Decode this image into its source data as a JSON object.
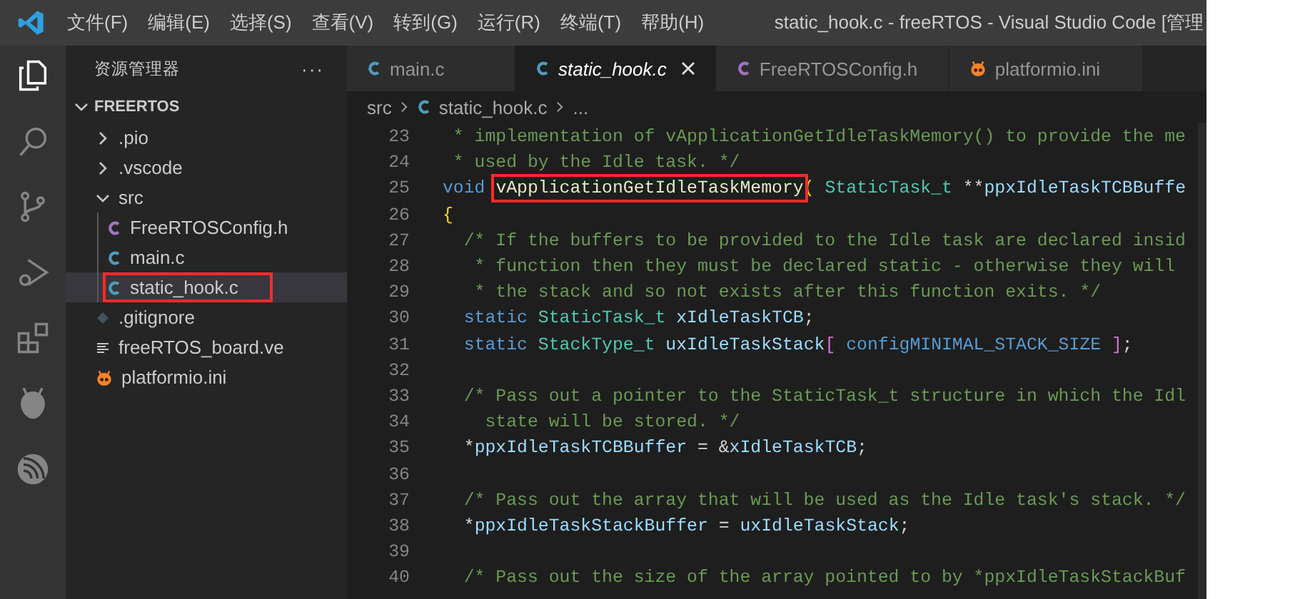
{
  "titlebar": {
    "menu": [
      "文件(F)",
      "编辑(E)",
      "选择(S)",
      "查看(V)",
      "转到(G)",
      "运行(R)",
      "终端(T)",
      "帮助(H)"
    ],
    "title": "static_hook.c - freeRTOS - Visual Studio Code [管理"
  },
  "activity_bar": [
    {
      "kind": "explorer",
      "selected": true
    },
    {
      "kind": "search",
      "selected": false
    },
    {
      "kind": "scm",
      "selected": false
    },
    {
      "kind": "debug",
      "selected": false
    },
    {
      "kind": "extensions",
      "selected": false
    },
    {
      "kind": "pio",
      "selected": false
    },
    {
      "kind": "espressif",
      "selected": false
    }
  ],
  "sidebar": {
    "title": "资源管理器",
    "more": "···",
    "section": {
      "label": "FREERTOS",
      "expanded": true
    },
    "tree": [
      {
        "label": ".pio",
        "kind": "folder",
        "expanded": false
      },
      {
        "label": ".vscode",
        "kind": "folder",
        "expanded": false
      },
      {
        "label": "src",
        "kind": "folder",
        "expanded": true,
        "children": [
          {
            "label": "FreeRTOSConfig.h",
            "kind": "h",
            "selected": false
          },
          {
            "label": "main.c",
            "kind": "c",
            "selected": false
          },
          {
            "label": "static_hook.c",
            "kind": "c",
            "selected": true,
            "boxed": true
          }
        ]
      },
      {
        "label": ".gitignore",
        "kind": "git",
        "selected": false
      },
      {
        "label": "freeRTOS_board.ve",
        "kind": "text",
        "selected": false
      },
      {
        "label": "platformio.ini",
        "kind": "pio",
        "selected": false
      }
    ]
  },
  "tabs": [
    {
      "label": "main.c",
      "kind": "c",
      "selected": false,
      "preview": false
    },
    {
      "label": "static_hook.c",
      "kind": "c",
      "selected": true,
      "preview": true
    },
    {
      "label": "FreeRTOSConfig.h",
      "kind": "h",
      "selected": false,
      "preview": false
    },
    {
      "label": "platformio.ini",
      "kind": "pio",
      "selected": false,
      "preview": false
    }
  ],
  "breadcrumb": [
    {
      "label": "src",
      "kind": "folder"
    },
    {
      "label": "static_hook.c",
      "kind": "c"
    },
    {
      "label": "...",
      "kind": "more"
    }
  ],
  "code": [
    {
      "number": "23",
      "tokens": [
        {
          "kind": "comment",
          "text": " * implementation of vApplicationGetIdleTaskMemory() to provide the me"
        }
      ]
    },
    {
      "number": "24",
      "tokens": [
        {
          "kind": "comment",
          "text": " * used by the Idle task. */"
        }
      ]
    },
    {
      "number": "25",
      "tokens": [
        {
          "kind": "keyword",
          "text": "void "
        },
        {
          "kind": "function",
          "text": "vApplicationGetIdleTaskMemory",
          "boxed": true
        },
        {
          "kind": "bracket",
          "text": "( "
        },
        {
          "kind": "type",
          "text": "StaticTask_t "
        },
        {
          "kind": "plain",
          "text": "**"
        },
        {
          "kind": "variable",
          "text": "ppxIdleTaskTCBBuffe"
        }
      ]
    },
    {
      "number": "26",
      "tokens": [
        {
          "kind": "bracket",
          "text": "{"
        }
      ]
    },
    {
      "number": "27",
      "tokens": [
        {
          "kind": "comment",
          "text": "  /* If the buffers to be provided to the Idle task are declared insid"
        }
      ]
    },
    {
      "number": "28",
      "tokens": [
        {
          "kind": "comment",
          "text": "   * function then they must be declared static - otherwise they will"
        }
      ]
    },
    {
      "number": "29",
      "tokens": [
        {
          "kind": "comment",
          "text": "   * the stack and so not exists after this function exits. */"
        }
      ]
    },
    {
      "number": "30",
      "tokens": [
        {
          "kind": "keyword",
          "text": "  static "
        },
        {
          "kind": "type",
          "text": "StaticTask_t "
        },
        {
          "kind": "variable",
          "text": "xIdleTaskTCB"
        },
        {
          "kind": "plain",
          "text": ";"
        }
      ]
    },
    {
      "number": "31",
      "tokens": [
        {
          "kind": "keyword",
          "text": "  static "
        },
        {
          "kind": "type",
          "text": "StackType_t "
        },
        {
          "kind": "variable",
          "text": "uxIdleTaskStack"
        },
        {
          "kind": "bracket2",
          "text": "[ "
        },
        {
          "kind": "macro",
          "text": "configMINIMAL_STACK_SIZE "
        },
        {
          "kind": "bracket2",
          "text": "]"
        },
        {
          "kind": "plain",
          "text": ";"
        }
      ]
    },
    {
      "number": "32"
    },
    {
      "number": "33",
      "tokens": [
        {
          "kind": "comment",
          "text": "  /* Pass out a pointer to the StaticTask_t structure in which the Idl"
        }
      ]
    },
    {
      "number": "34",
      "tokens": [
        {
          "kind": "comment",
          "text": "    state will be stored. */"
        }
      ]
    },
    {
      "number": "35",
      "tokens": [
        {
          "kind": "plain",
          "text": "  *"
        },
        {
          "kind": "variable",
          "text": "ppxIdleTaskTCBBuffer"
        },
        {
          "kind": "plain",
          "text": " = &"
        },
        {
          "kind": "variable",
          "text": "xIdleTaskTCB"
        },
        {
          "kind": "plain",
          "text": ";"
        }
      ]
    },
    {
      "number": "36"
    },
    {
      "number": "37",
      "tokens": [
        {
          "kind": "comment",
          "text": "  /* Pass out the array that will be used as the Idle task's stack. */"
        }
      ]
    },
    {
      "number": "38",
      "tokens": [
        {
          "kind": "plain",
          "text": "  *"
        },
        {
          "kind": "variable",
          "text": "ppxIdleTaskStackBuffer"
        },
        {
          "kind": "plain",
          "text": " = "
        },
        {
          "kind": "variable",
          "text": "uxIdleTaskStack"
        },
        {
          "kind": "plain",
          "text": ";"
        }
      ]
    },
    {
      "number": "39"
    },
    {
      "number": "40",
      "tokens": [
        {
          "kind": "comment",
          "text": "  /* Pass out the size of the array pointed to by *ppxIdleTaskStackBuf"
        }
      ]
    }
  ]
}
